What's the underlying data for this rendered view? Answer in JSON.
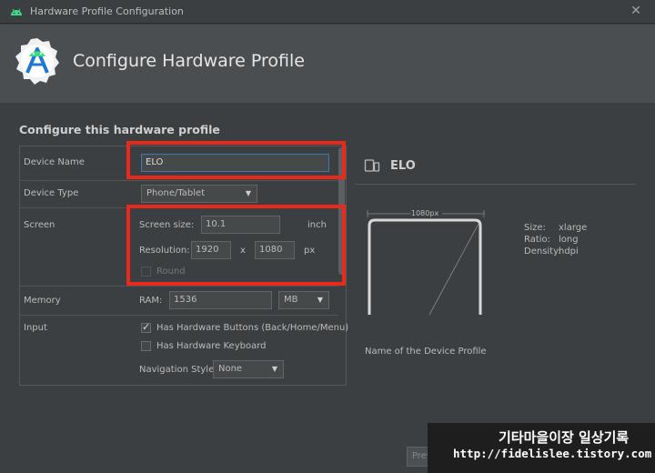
{
  "window": {
    "title": "Hardware Profile Configuration",
    "close_glyph": "✕"
  },
  "banner": {
    "title": "Configure Hardware Profile"
  },
  "section_title": "Configure this hardware profile",
  "form": {
    "device_name": {
      "label": "Device Name",
      "value": "ELO"
    },
    "device_type": {
      "label": "Device Type",
      "value": "Phone/Tablet"
    },
    "screen": {
      "label": "Screen",
      "size_label": "Screen size:",
      "size_value": "10.1",
      "size_unit": "inch",
      "resolution_label": "Resolution:",
      "res_w": "1920",
      "res_x": "x",
      "res_h": "1080",
      "res_unit": "px",
      "round_label": "Round"
    },
    "memory": {
      "label": "Memory",
      "ram_label": "RAM:",
      "ram_value": "1536",
      "ram_unit": "MB"
    },
    "input": {
      "label": "Input",
      "hw_buttons_label": "Has Hardware Buttons (Back/Home/Menu)",
      "hw_buttons_checked": true,
      "hw_keyboard_label": "Has Hardware Keyboard",
      "hw_keyboard_checked": false,
      "nav_style_label": "Navigation Style:",
      "nav_style_value": "None"
    }
  },
  "preview": {
    "name": "ELO",
    "width_label": "1080px",
    "size_key": "Size:",
    "size_val": "xlarge",
    "ratio_key": "Ratio:",
    "ratio_val": "long",
    "density_key": "Density:",
    "density_val": "hdpi",
    "description": "Name of the Device Profile"
  },
  "footer": {
    "previous_label": "Previous"
  },
  "watermark": {
    "line1": "기타마을이장 일상기록",
    "line2": "http://fidelislee.tistory.com"
  },
  "colors": {
    "highlight": "#e8291c",
    "focus": "#3d7ab3",
    "android_green": "#3ddc84"
  }
}
